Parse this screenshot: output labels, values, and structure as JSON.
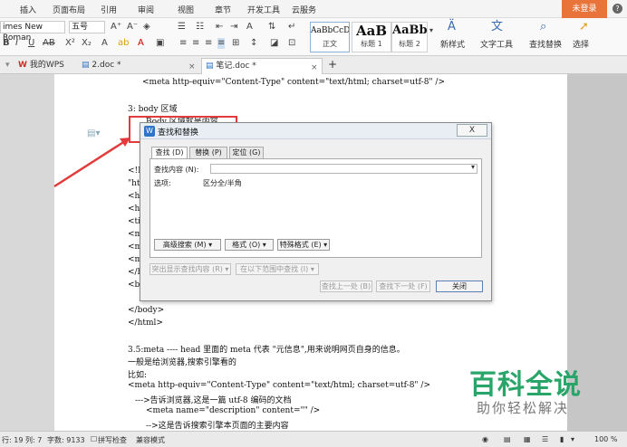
{
  "menu": {
    "tabs": [
      "插入",
      "页面布局",
      "引用",
      "审阅",
      "视图",
      "章节",
      "开发工具",
      "云服务"
    ],
    "login": "未登录",
    "help": "?"
  },
  "ribbon": {
    "font_name": "imes New Roman",
    "font_size": "五号",
    "format_buttons": [
      "B",
      "I",
      "U",
      "AB",
      "X²",
      "X₂"
    ],
    "styles": [
      {
        "sample": "AaBbCcD",
        "name": "正文"
      },
      {
        "sample": "AaB",
        "name": "标题 1"
      },
      {
        "sample": "AaBb(",
        "name": "标题 2"
      }
    ],
    "new_style": "新样式",
    "text_tools": "文字工具",
    "find_replace": "查找替换",
    "select": "选择"
  },
  "doc_tabs": {
    "items": [
      {
        "label": "我的WPS"
      },
      {
        "label": "2.doc *"
      },
      {
        "label": "笔记.doc *"
      }
    ],
    "add": "+"
  },
  "document": {
    "lines": [
      "<meta http-equiv=\"Content-Type\" content=\"text/html; charset=utf-8\" />",
      "3: body 区域",
      "Body 区域就是内容",
      "<!I",
      "\"ht",
      "<ht",
      "<he",
      "<tit",
      "<m",
      "<m",
      "<m",
      "</h",
      "<bo",
      "</body>",
      "</html>",
      "3.5:meta ---- head 里面的 meta 代表 \"元信息\",用来说明网页自身的信息。",
      "一般是给浏览器,搜索引擎看的",
      "比如:",
      "<meta http-equiv=\"Content-Type\" content=\"text/html; charset=utf-8\" />",
      "--->告诉浏览器,这是一篇 utf-8 编码的文档",
      "<meta name=\"description\" content=\"\" />",
      "-->这是告诉搜索引擎本页面的主要内容"
    ]
  },
  "dialog": {
    "title": "查找和替换",
    "close": "X",
    "tabs": [
      "查找 (D)",
      "替换 (P)",
      "定位 (G)"
    ],
    "find_label": "查找内容 (N):",
    "find_value": "",
    "options_label": "选项:",
    "options_value": "区分全/半角",
    "advanced_btn": "高级搜索 (M) ▾",
    "format_btn": "格式 (O) ▾",
    "special_btn": "特殊格式 (E) ▾",
    "highlight_btn": "突出显示查找内容 (R) ▾",
    "within_btn": "在以下范围中查找 (I) ▾",
    "find_prev_btn": "查找上一处 (B)",
    "find_next_btn": "查找下一处 (F)",
    "close_btn": "关闭"
  },
  "status": {
    "line": "行: 19",
    "col": "列: 7",
    "words": "字数: 9133",
    "spell": "拼写检查",
    "compat": "兼容模式",
    "zoom": "100 %"
  },
  "watermark": {
    "main": "百科全说",
    "sub": "助你轻松解决"
  },
  "colors": {
    "accent": "#e8743a",
    "highlight": "#e23b3b",
    "watermark": "#2aa56a"
  }
}
